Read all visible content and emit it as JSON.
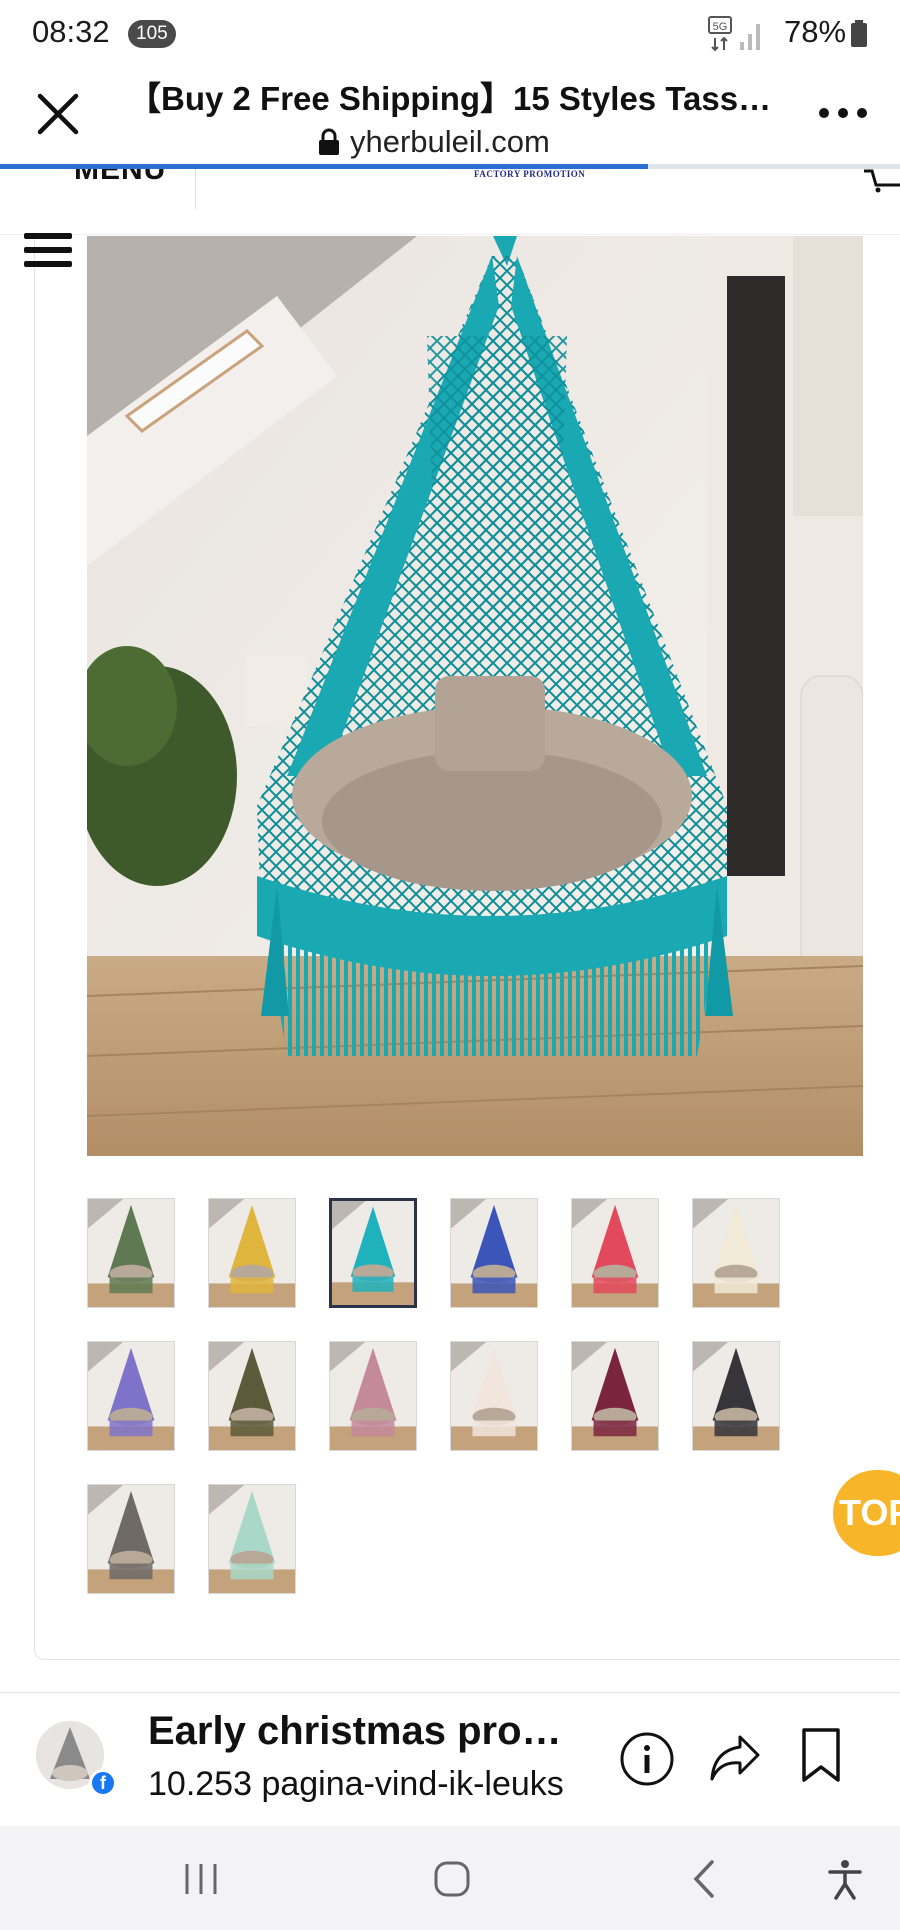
{
  "status_bar": {
    "time": "08:32",
    "notification_count": "105",
    "network": "5G",
    "battery_percent": "78%"
  },
  "browser": {
    "title": "【Buy 2 Free Shipping】15 Styles Tass…",
    "url": "yherbuleil.com",
    "load_progress": 0.72
  },
  "page_header": {
    "menu_label": "MENU",
    "logo_tagline": "FACTORY PROMOTION"
  },
  "product": {
    "selected_color": "turquoise",
    "thumbnails": [
      {
        "color": "#5f7a52"
      },
      {
        "color": "#e0b53d"
      },
      {
        "color": "#1fb2bd"
      },
      {
        "color": "#3b55b8"
      },
      {
        "color": "#e2495a"
      },
      {
        "color": "#f1ead7"
      },
      {
        "color": "#7f73c9"
      },
      {
        "color": "#5c5a38"
      },
      {
        "color": "#c48a9b"
      },
      {
        "color": "#f2e5de"
      },
      {
        "color": "#7b2440"
      },
      {
        "color": "#35353a"
      },
      {
        "color": "#6f6a66"
      },
      {
        "color": "#a9d8c8"
      }
    ]
  },
  "top_button": {
    "label": "TOP"
  },
  "ad": {
    "page_name": "Early christmas pro…",
    "likes": "10.253 pagina-vind-ik-leuks"
  },
  "colors": {
    "accent_progress": "#2a6fd1",
    "top_button": "#f7b52a",
    "facebook_blue": "#1877f2",
    "product_main": "#1fb2bd"
  }
}
